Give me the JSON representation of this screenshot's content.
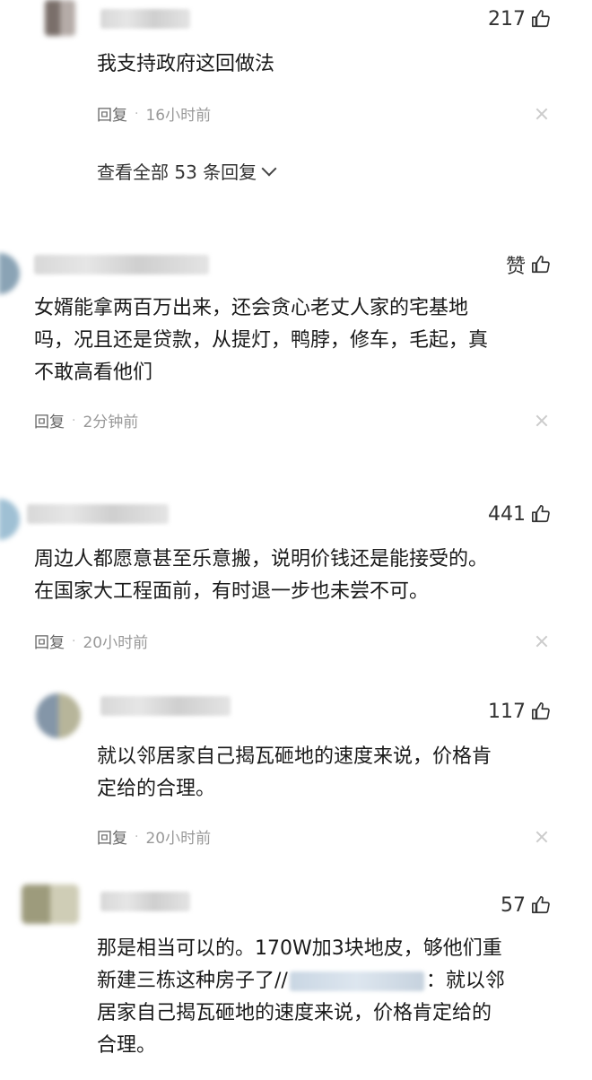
{
  "comments": [
    {
      "likes": "217",
      "text": "我支持政府这回做法",
      "reply_label": "回复",
      "time": "16小时前",
      "view_all": "查看全部 53 条回复"
    },
    {
      "likes": "赞",
      "text_lines": [
        "女婿能拿两百万出来，还会贪心老丈人家的宅基地",
        "吗，况且还是贷款，从提灯，鸭脖，修车，毛起，真",
        "不敢高看他们"
      ],
      "reply_label": "回复",
      "time": "2分钟前"
    },
    {
      "likes": "441",
      "text_lines": [
        "周边人都愿意甚至乐意搬，说明价钱还是能接受的。",
        "在国家大工程面前，有时退一步也未尝不可。"
      ],
      "reply_label": "回复",
      "time": "20小时前"
    },
    {
      "likes": "117",
      "text_lines": [
        "就以邻居家自己揭瓦砸地的速度来说，价格肯",
        "定给的合理。"
      ],
      "reply_label": "回复",
      "time": "20小时前"
    },
    {
      "likes": "57",
      "text_lines": [
        "那是相当可以的。170W加3块地皮，够他们重",
        "新建三栋这种房子了//",
        "：就以邻",
        "居家自己揭瓦砸地的速度来说，价格肯定给的",
        "合理。"
      ]
    }
  ],
  "icons": {
    "like": "thumbs-up-icon",
    "close": "close-icon",
    "expand": "chevron-down-icon"
  }
}
